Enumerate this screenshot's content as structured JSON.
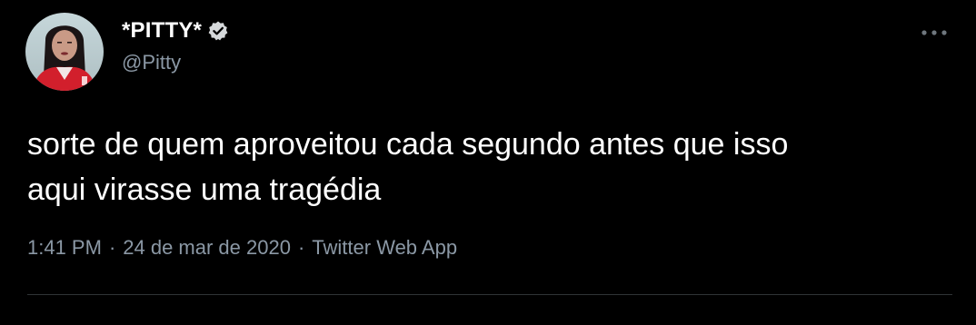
{
  "user": {
    "display_name": "*PITTY*",
    "handle": "@Pitty",
    "verified": true,
    "avatar": "avatar-photo"
  },
  "tweet": {
    "text": "sorte de quem aproveitou cada segundo antes que isso\naqui virasse uma tragédia",
    "time": "1:41 PM",
    "date": "24 de mar de 2020",
    "source": "Twitter Web App",
    "separator": "·"
  },
  "icons": {
    "verified": "verified-badge-icon",
    "more": "more-options-icon"
  },
  "colors": {
    "background": "#000000",
    "primary_text": "#ffffff",
    "secondary_text": "#8b98a5",
    "divider": "#2f3336"
  }
}
